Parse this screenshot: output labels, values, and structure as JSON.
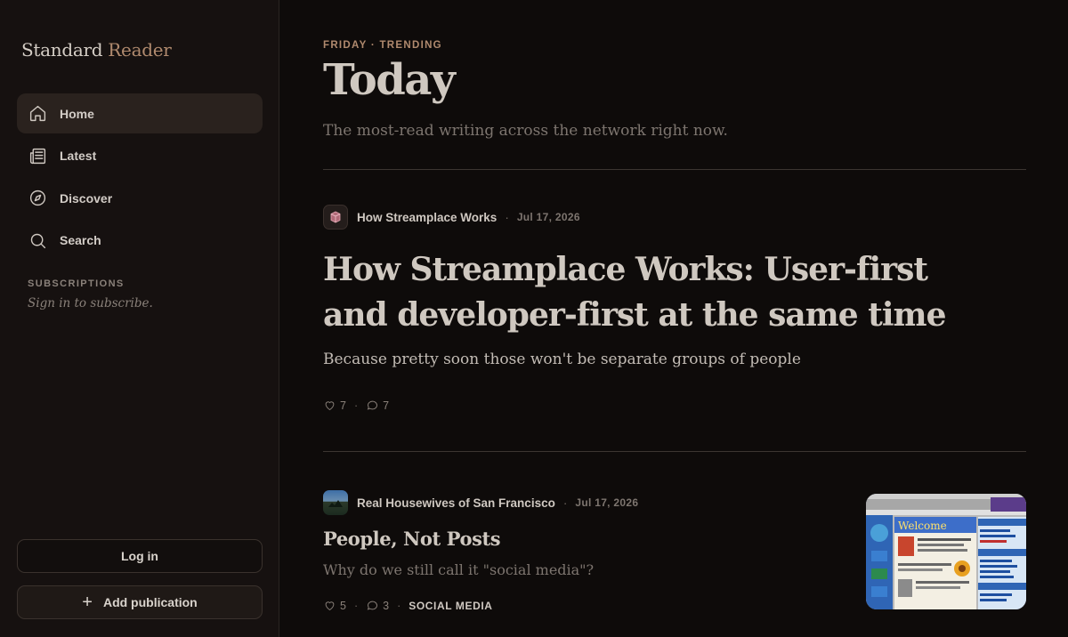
{
  "brand": {
    "name_part1": "Standard",
    "name_part2": "Reader"
  },
  "sidebar": {
    "nav": [
      {
        "label": "Home",
        "icon": "home-icon",
        "active": true
      },
      {
        "label": "Latest",
        "icon": "newspaper-icon"
      },
      {
        "label": "Discover",
        "icon": "compass-icon"
      },
      {
        "label": "Search",
        "icon": "search-icon"
      }
    ],
    "subscriptions_title": "SUBSCRIPTIONS",
    "subscriptions_hint": "Sign in to subscribe.",
    "login_label": "Log in",
    "add_publication_label": "Add publication"
  },
  "header": {
    "eyebrow": "FRIDAY · TRENDING",
    "title": "Today",
    "subtitle": "The most-read writing across the network right now."
  },
  "articles": [
    {
      "publication": "How Streamplace Works",
      "date": "Jul 17, 2026",
      "title_line1": "How Streamplace Works: User-first",
      "title_line2": "and developer-first at the same time",
      "subtitle": "Because pretty soon those won't be separate groups of people",
      "likes": "7",
      "comments": "7"
    },
    {
      "publication": "Real Housewives of San Francisco",
      "date": "Jul 17, 2026",
      "title": "People, Not Posts",
      "subtitle": "Why do we still call it \"social media\"?",
      "likes": "5",
      "comments": "3",
      "tag": "SOCIAL MEDIA",
      "thumbnail_text": "Welcome"
    }
  ],
  "colors": {
    "background": "#0e0b0a",
    "sidebar": "#161110",
    "accent": "#b08a6e",
    "active_nav": "#2a221e"
  }
}
